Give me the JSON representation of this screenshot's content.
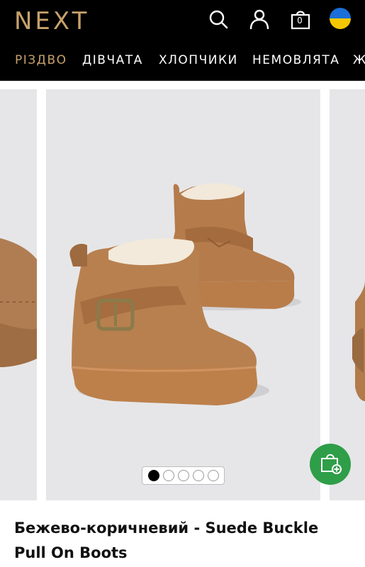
{
  "brand": {
    "logo_text": "NEXT",
    "accent_color": "#c7a16b"
  },
  "header": {
    "icons": [
      "search-icon",
      "account-icon",
      "bag-icon",
      "ukraine-flag-icon"
    ],
    "bag_count": "0"
  },
  "nav": {
    "items": [
      {
        "label": "РІЗДВО",
        "active": true
      },
      {
        "label": "ДІВЧАТА",
        "active": false
      },
      {
        "label": "ХЛОПЧИКИ",
        "active": false
      },
      {
        "label": "НЕМОВЛЯТА",
        "active": false
      },
      {
        "label": "Ж",
        "active": false
      }
    ]
  },
  "gallery": {
    "slide_count": 5,
    "active_index": 0,
    "add_to_bag_icon": "bag-plus-icon",
    "fab_color": "#2e9e48"
  },
  "product": {
    "title": "Бежево-коричневий - Suede Buckle Pull On Boots"
  }
}
